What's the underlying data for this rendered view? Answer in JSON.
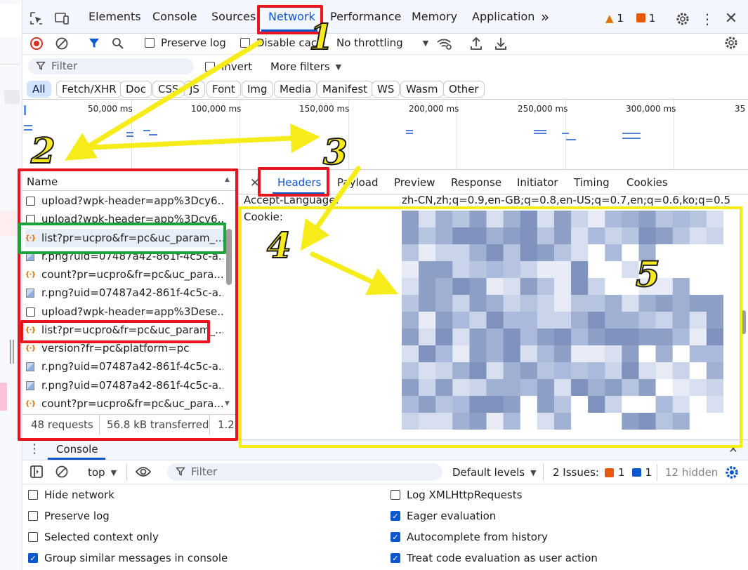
{
  "tabs": [
    {
      "label": "Elements"
    },
    {
      "label": "Console"
    },
    {
      "label": "Sources"
    },
    {
      "label": "Network"
    },
    {
      "label": "Performance"
    },
    {
      "label": "Memory"
    },
    {
      "label": "Application"
    }
  ],
  "tabs_more": "»",
  "badges": {
    "warnings": "1",
    "errors": "1"
  },
  "toolbar": {
    "preserve_log": "Preserve log",
    "disable_cache": "Disable cach",
    "throttling": "No throttling"
  },
  "filter": {
    "placeholder": "Filter",
    "invert": "Invert",
    "more_filters": "More filters"
  },
  "type_chips": [
    "All",
    "Fetch/XHR",
    "Doc",
    "CSS",
    "JS",
    "Font",
    "Img",
    "Media",
    "Manifest",
    "WS",
    "Wasm",
    "Other"
  ],
  "timeline_ticks": [
    "50,000 ms",
    "100,000 ms",
    "150,000 ms",
    "200,000 ms",
    "250,000 ms",
    "300,000 ms",
    "35"
  ],
  "requests": {
    "header": "Name",
    "rows": [
      {
        "name": "upload?wpk-header=app%3Dcy6...",
        "type": "doc"
      },
      {
        "name": "upload?wpk-header=app%3Dcy6...",
        "type": "doc"
      },
      {
        "name": "list?pr=ucpro&fr=pc&uc_param_...",
        "type": "xhr"
      },
      {
        "name": "r.png?uid=07487a42-861f-4c5c-a...",
        "type": "img"
      },
      {
        "name": "count?pr=ucpro&fr=pc&uc_para...",
        "type": "xhr"
      },
      {
        "name": "r.png?uid=07487a42-861f-4c5c-a...",
        "type": "img"
      },
      {
        "name": "upload?wpk-header=app%3Dese...",
        "type": "doc"
      },
      {
        "name": "list?pr=ucpro&fr=pc&uc_param_...",
        "type": "xhr"
      },
      {
        "name": "version?fr=pc&platform=pc",
        "type": "xhr"
      },
      {
        "name": "r.png?uid=07487a42-861f-4c5c-a...",
        "type": "img"
      },
      {
        "name": "r.png?uid=07487a42-861f-4c5c-a...",
        "type": "img"
      },
      {
        "name": "count?pr=ucpro&fr=pc&uc_para...",
        "type": "xhr"
      }
    ],
    "status": {
      "count": "48 requests",
      "transferred": "56.8 kB transferred",
      "more": "1.2"
    }
  },
  "details": {
    "tabs": [
      "Headers",
      "Payload",
      "Preview",
      "Response",
      "Initiator",
      "Timing",
      "Cookies"
    ],
    "accept_language_key": "Accept-Language:",
    "accept_language_val": "zh-CN,zh;q=0.9,en-GB;q=0.8,en-US;q=0.7,en;q=0.6,ko;q=0.5",
    "cookie_key": "Cookie:"
  },
  "console": {
    "tab": "Console",
    "context": "top",
    "filter_placeholder": "Filter",
    "levels": "Default levels",
    "issues_label": "2 Issues:",
    "issues_warn": "1",
    "issues_info": "1",
    "hidden": "12 hidden",
    "options_left": [
      {
        "label": "Hide network",
        "checked": false
      },
      {
        "label": "Preserve log",
        "checked": false
      },
      {
        "label": "Selected context only",
        "checked": false
      },
      {
        "label": "Group similar messages in console",
        "checked": true
      }
    ],
    "options_right": [
      {
        "label": "Log XMLHttpRequests",
        "checked": false
      },
      {
        "label": "Eager evaluation",
        "checked": true
      },
      {
        "label": "Autocomplete from history",
        "checked": true
      },
      {
        "label": "Treat code evaluation as user action",
        "checked": true
      }
    ]
  },
  "annotations": {
    "n1": "1",
    "n2": "2",
    "n3": "3",
    "n4": "4",
    "n5": "5"
  },
  "colors": {
    "accent": "#0b57d0",
    "red_box": "#e8141e",
    "green_box": "#1ca33b",
    "yellow": "#f5ec1a"
  }
}
